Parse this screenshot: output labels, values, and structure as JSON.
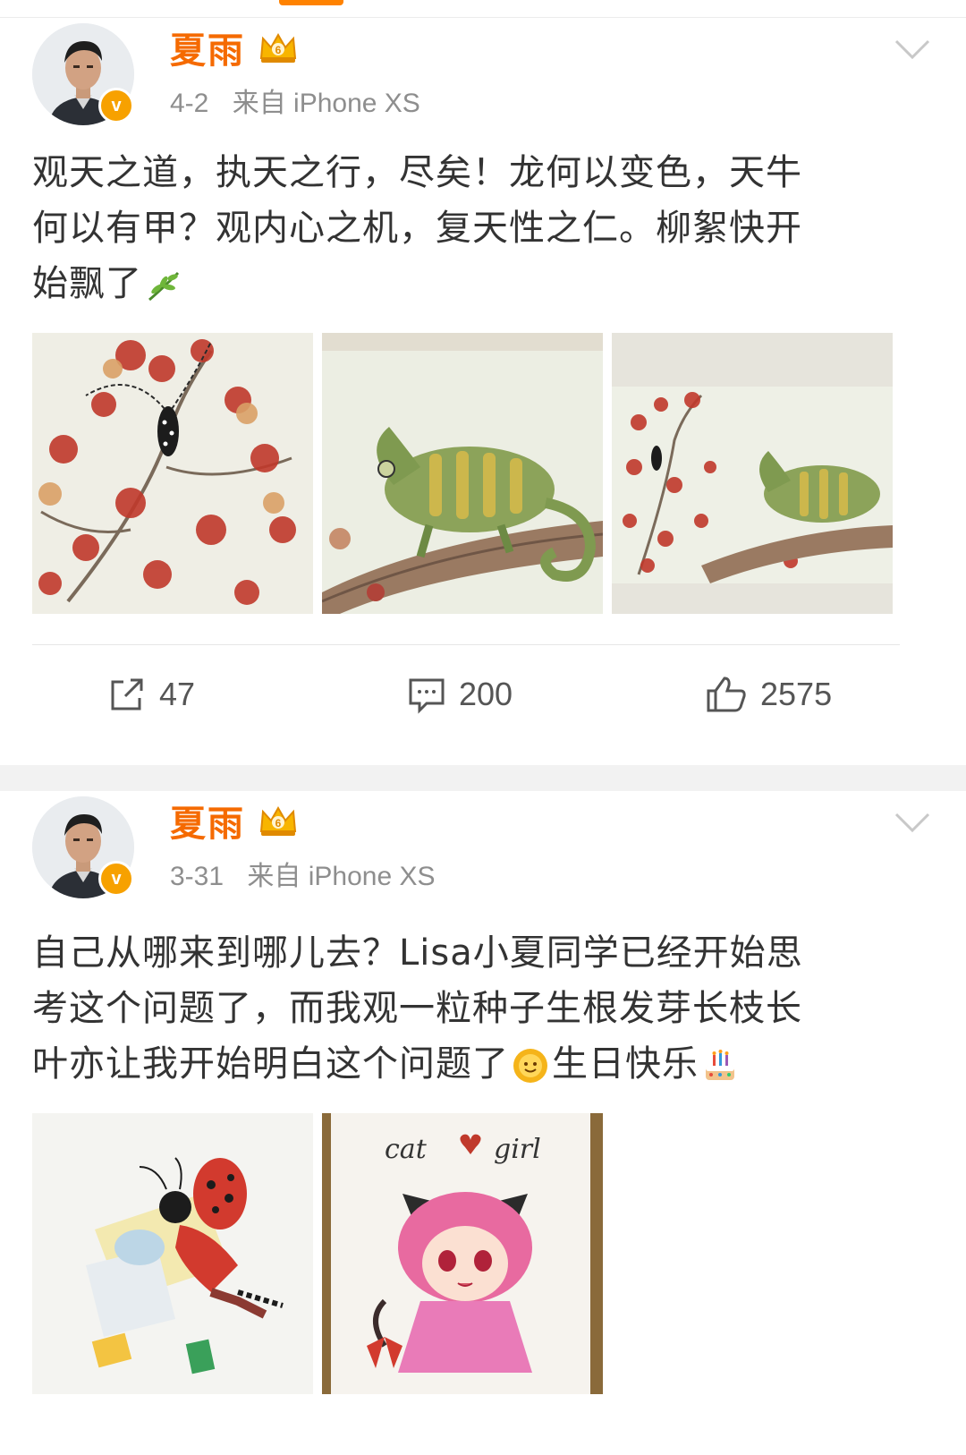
{
  "posts": [
    {
      "username": "夏雨",
      "date": "4-2",
      "source": "来自 iPhone XS",
      "text": {
        "line1": "观天之道，执天之行，尽矣！龙何以变色，天牛",
        "line2": "何以有甲？观内心之机，复天性之仁。柳絮快开",
        "line3": "始飘了"
      },
      "images": [
        "insect-on-leaves-painting",
        "chameleon-painting",
        "combined-painting"
      ],
      "actions": {
        "repost": "47",
        "comments": "200",
        "likes": "2575"
      }
    },
    {
      "username": "夏雨",
      "date": "3-31",
      "source": "来自 iPhone XS",
      "text": {
        "line1": "自己从哪来到哪儿去？Lisa小夏同学已经开始思",
        "line2": "考这个问题了，而我观一粒种子生根发芽长枝长",
        "line3a": "叶亦让我开始明白这个问题了",
        "line3b": "生日快乐"
      },
      "images": [
        "ladybug-girl-drawing",
        "cat-girl-drawing"
      ],
      "catgirl_caption": {
        "word1": "cat",
        "word2": "girl"
      }
    }
  ]
}
